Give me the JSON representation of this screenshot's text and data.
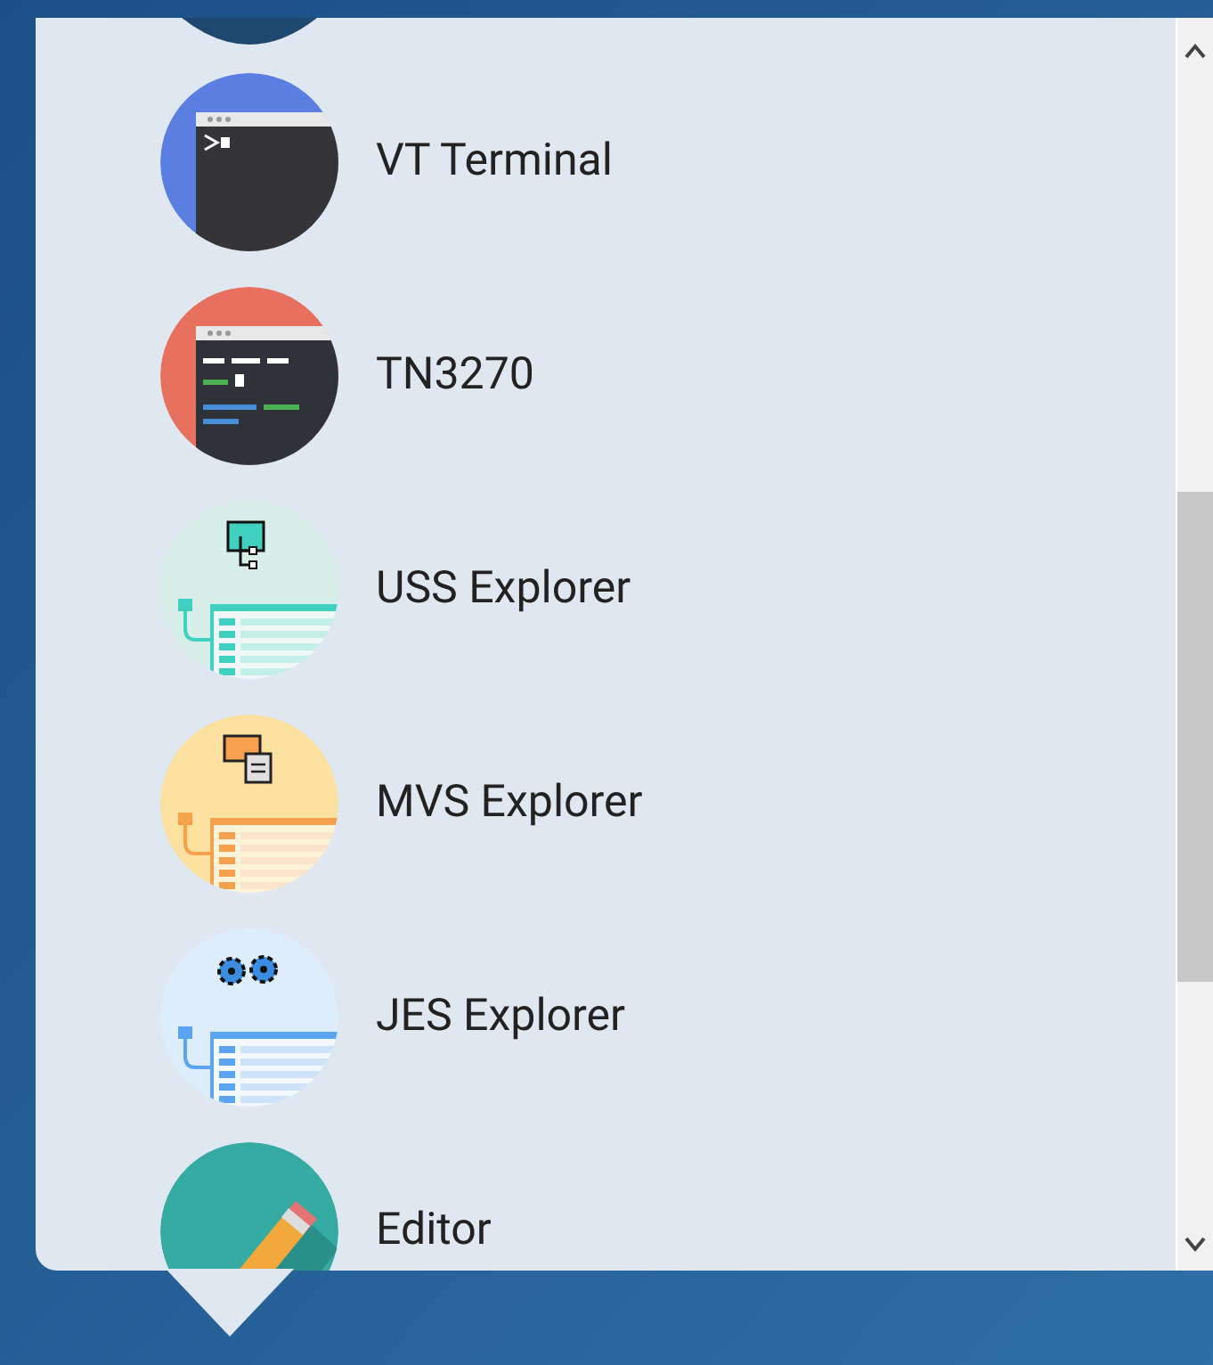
{
  "apps": [
    {
      "label": "VT Terminal",
      "kind": "vt"
    },
    {
      "label": "TN3270",
      "kind": "tn"
    },
    {
      "label": "USS Explorer",
      "kind": "uss"
    },
    {
      "label": "MVS Explorer",
      "kind": "mvs"
    },
    {
      "label": "JES Explorer",
      "kind": "jes"
    },
    {
      "label": "Editor",
      "kind": "editor"
    }
  ]
}
